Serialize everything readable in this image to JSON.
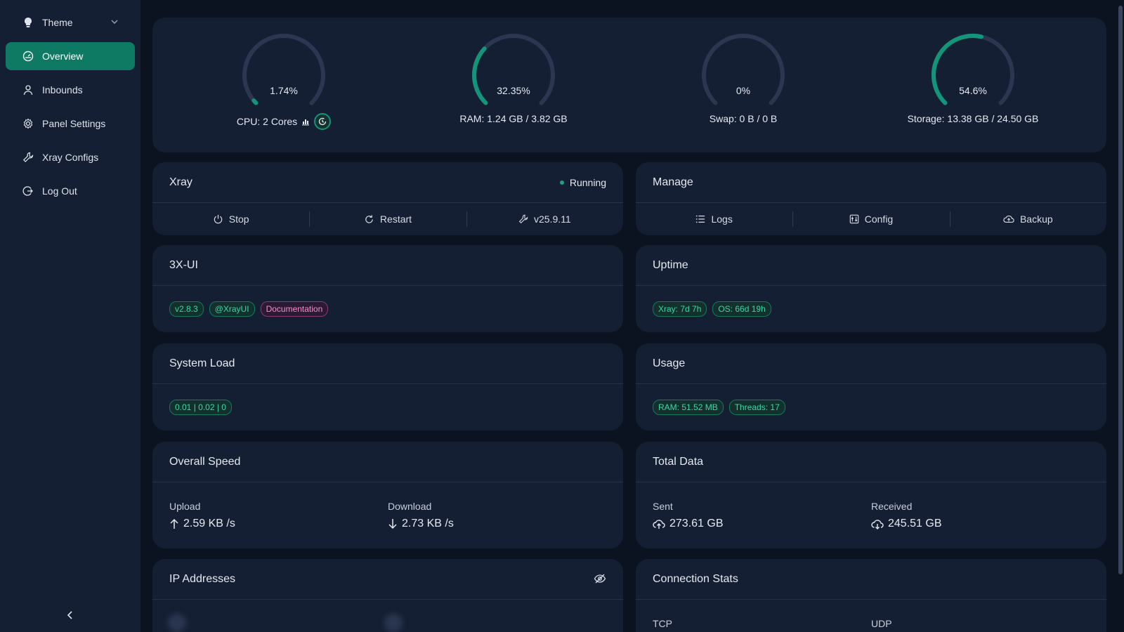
{
  "colors": {
    "accent": "#0f7a64",
    "gauge_track": "#2b3750",
    "gauge_fill": "#13957a",
    "tag_green": "#3fd6a5",
    "tag_pink": "#f08fd0"
  },
  "sidebar": {
    "theme_label": "Theme",
    "items": [
      {
        "label": "Overview",
        "icon": "dashboard-icon"
      },
      {
        "label": "Inbounds",
        "icon": "user-icon"
      },
      {
        "label": "Panel Settings",
        "icon": "gear-icon"
      },
      {
        "label": "Xray Configs",
        "icon": "tool-icon"
      },
      {
        "label": "Log Out",
        "icon": "logout-icon"
      }
    ]
  },
  "gauges": [
    {
      "value": 1.74,
      "text": "1.74%",
      "label": "CPU: 2 Cores"
    },
    {
      "value": 32.35,
      "text": "32.35%",
      "label": "RAM: 1.24 GB / 3.82 GB"
    },
    {
      "value": 0,
      "text": "0%",
      "label": "Swap: 0 B / 0 B"
    },
    {
      "value": 54.6,
      "text": "54.6%",
      "label": "Storage: 13.38 GB / 24.50 GB"
    }
  ],
  "xray": {
    "title": "Xray",
    "status": "Running",
    "stop": "Stop",
    "restart": "Restart",
    "version": "v25.9.11"
  },
  "manage": {
    "title": "Manage",
    "logs": "Logs",
    "config": "Config",
    "backup": "Backup"
  },
  "panel": {
    "title": "3X-UI",
    "version": "v2.8.3",
    "channel": "@XrayUI",
    "docs": "Documentation"
  },
  "uptime": {
    "title": "Uptime",
    "xray": "Xray: 7d 7h",
    "os": "OS: 66d 19h"
  },
  "load": {
    "title": "System Load",
    "value": "0.01 | 0.02 | 0"
  },
  "usage": {
    "title": "Usage",
    "ram": "RAM: 51.52 MB",
    "threads": "Threads: 17"
  },
  "speed": {
    "title": "Overall Speed",
    "upload_label": "Upload",
    "upload": "2.59 KB /s",
    "download_label": "Download",
    "download": "2.73 KB /s"
  },
  "total": {
    "title": "Total Data",
    "sent_label": "Sent",
    "sent": "273.61 GB",
    "received_label": "Received",
    "received": "245.51 GB"
  },
  "ip": {
    "title": "IP Addresses"
  },
  "conn": {
    "title": "Connection Stats",
    "tcp_label": "TCP",
    "udp_label": "UDP"
  }
}
